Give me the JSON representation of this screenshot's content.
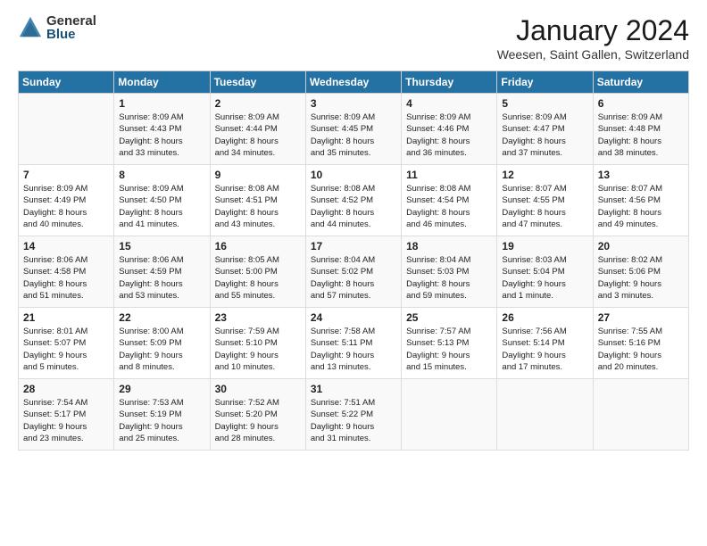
{
  "logo": {
    "general": "General",
    "blue": "Blue"
  },
  "title": "January 2024",
  "location": "Weesen, Saint Gallen, Switzerland",
  "headers": [
    "Sunday",
    "Monday",
    "Tuesday",
    "Wednesday",
    "Thursday",
    "Friday",
    "Saturday"
  ],
  "weeks": [
    [
      {
        "day": "",
        "lines": []
      },
      {
        "day": "1",
        "lines": [
          "Sunrise: 8:09 AM",
          "Sunset: 4:43 PM",
          "Daylight: 8 hours",
          "and 33 minutes."
        ]
      },
      {
        "day": "2",
        "lines": [
          "Sunrise: 8:09 AM",
          "Sunset: 4:44 PM",
          "Daylight: 8 hours",
          "and 34 minutes."
        ]
      },
      {
        "day": "3",
        "lines": [
          "Sunrise: 8:09 AM",
          "Sunset: 4:45 PM",
          "Daylight: 8 hours",
          "and 35 minutes."
        ]
      },
      {
        "day": "4",
        "lines": [
          "Sunrise: 8:09 AM",
          "Sunset: 4:46 PM",
          "Daylight: 8 hours",
          "and 36 minutes."
        ]
      },
      {
        "day": "5",
        "lines": [
          "Sunrise: 8:09 AM",
          "Sunset: 4:47 PM",
          "Daylight: 8 hours",
          "and 37 minutes."
        ]
      },
      {
        "day": "6",
        "lines": [
          "Sunrise: 8:09 AM",
          "Sunset: 4:48 PM",
          "Daylight: 8 hours",
          "and 38 minutes."
        ]
      }
    ],
    [
      {
        "day": "7",
        "lines": [
          "Sunrise: 8:09 AM",
          "Sunset: 4:49 PM",
          "Daylight: 8 hours",
          "and 40 minutes."
        ]
      },
      {
        "day": "8",
        "lines": [
          "Sunrise: 8:09 AM",
          "Sunset: 4:50 PM",
          "Daylight: 8 hours",
          "and 41 minutes."
        ]
      },
      {
        "day": "9",
        "lines": [
          "Sunrise: 8:08 AM",
          "Sunset: 4:51 PM",
          "Daylight: 8 hours",
          "and 43 minutes."
        ]
      },
      {
        "day": "10",
        "lines": [
          "Sunrise: 8:08 AM",
          "Sunset: 4:52 PM",
          "Daylight: 8 hours",
          "and 44 minutes."
        ]
      },
      {
        "day": "11",
        "lines": [
          "Sunrise: 8:08 AM",
          "Sunset: 4:54 PM",
          "Daylight: 8 hours",
          "and 46 minutes."
        ]
      },
      {
        "day": "12",
        "lines": [
          "Sunrise: 8:07 AM",
          "Sunset: 4:55 PM",
          "Daylight: 8 hours",
          "and 47 minutes."
        ]
      },
      {
        "day": "13",
        "lines": [
          "Sunrise: 8:07 AM",
          "Sunset: 4:56 PM",
          "Daylight: 8 hours",
          "and 49 minutes."
        ]
      }
    ],
    [
      {
        "day": "14",
        "lines": [
          "Sunrise: 8:06 AM",
          "Sunset: 4:58 PM",
          "Daylight: 8 hours",
          "and 51 minutes."
        ]
      },
      {
        "day": "15",
        "lines": [
          "Sunrise: 8:06 AM",
          "Sunset: 4:59 PM",
          "Daylight: 8 hours",
          "and 53 minutes."
        ]
      },
      {
        "day": "16",
        "lines": [
          "Sunrise: 8:05 AM",
          "Sunset: 5:00 PM",
          "Daylight: 8 hours",
          "and 55 minutes."
        ]
      },
      {
        "day": "17",
        "lines": [
          "Sunrise: 8:04 AM",
          "Sunset: 5:02 PM",
          "Daylight: 8 hours",
          "and 57 minutes."
        ]
      },
      {
        "day": "18",
        "lines": [
          "Sunrise: 8:04 AM",
          "Sunset: 5:03 PM",
          "Daylight: 8 hours",
          "and 59 minutes."
        ]
      },
      {
        "day": "19",
        "lines": [
          "Sunrise: 8:03 AM",
          "Sunset: 5:04 PM",
          "Daylight: 9 hours",
          "and 1 minute."
        ]
      },
      {
        "day": "20",
        "lines": [
          "Sunrise: 8:02 AM",
          "Sunset: 5:06 PM",
          "Daylight: 9 hours",
          "and 3 minutes."
        ]
      }
    ],
    [
      {
        "day": "21",
        "lines": [
          "Sunrise: 8:01 AM",
          "Sunset: 5:07 PM",
          "Daylight: 9 hours",
          "and 5 minutes."
        ]
      },
      {
        "day": "22",
        "lines": [
          "Sunrise: 8:00 AM",
          "Sunset: 5:09 PM",
          "Daylight: 9 hours",
          "and 8 minutes."
        ]
      },
      {
        "day": "23",
        "lines": [
          "Sunrise: 7:59 AM",
          "Sunset: 5:10 PM",
          "Daylight: 9 hours",
          "and 10 minutes."
        ]
      },
      {
        "day": "24",
        "lines": [
          "Sunrise: 7:58 AM",
          "Sunset: 5:11 PM",
          "Daylight: 9 hours",
          "and 13 minutes."
        ]
      },
      {
        "day": "25",
        "lines": [
          "Sunrise: 7:57 AM",
          "Sunset: 5:13 PM",
          "Daylight: 9 hours",
          "and 15 minutes."
        ]
      },
      {
        "day": "26",
        "lines": [
          "Sunrise: 7:56 AM",
          "Sunset: 5:14 PM",
          "Daylight: 9 hours",
          "and 17 minutes."
        ]
      },
      {
        "day": "27",
        "lines": [
          "Sunrise: 7:55 AM",
          "Sunset: 5:16 PM",
          "Daylight: 9 hours",
          "and 20 minutes."
        ]
      }
    ],
    [
      {
        "day": "28",
        "lines": [
          "Sunrise: 7:54 AM",
          "Sunset: 5:17 PM",
          "Daylight: 9 hours",
          "and 23 minutes."
        ]
      },
      {
        "day": "29",
        "lines": [
          "Sunrise: 7:53 AM",
          "Sunset: 5:19 PM",
          "Daylight: 9 hours",
          "and 25 minutes."
        ]
      },
      {
        "day": "30",
        "lines": [
          "Sunrise: 7:52 AM",
          "Sunset: 5:20 PM",
          "Daylight: 9 hours",
          "and 28 minutes."
        ]
      },
      {
        "day": "31",
        "lines": [
          "Sunrise: 7:51 AM",
          "Sunset: 5:22 PM",
          "Daylight: 9 hours",
          "and 31 minutes."
        ]
      },
      {
        "day": "",
        "lines": []
      },
      {
        "day": "",
        "lines": []
      },
      {
        "day": "",
        "lines": []
      }
    ]
  ]
}
